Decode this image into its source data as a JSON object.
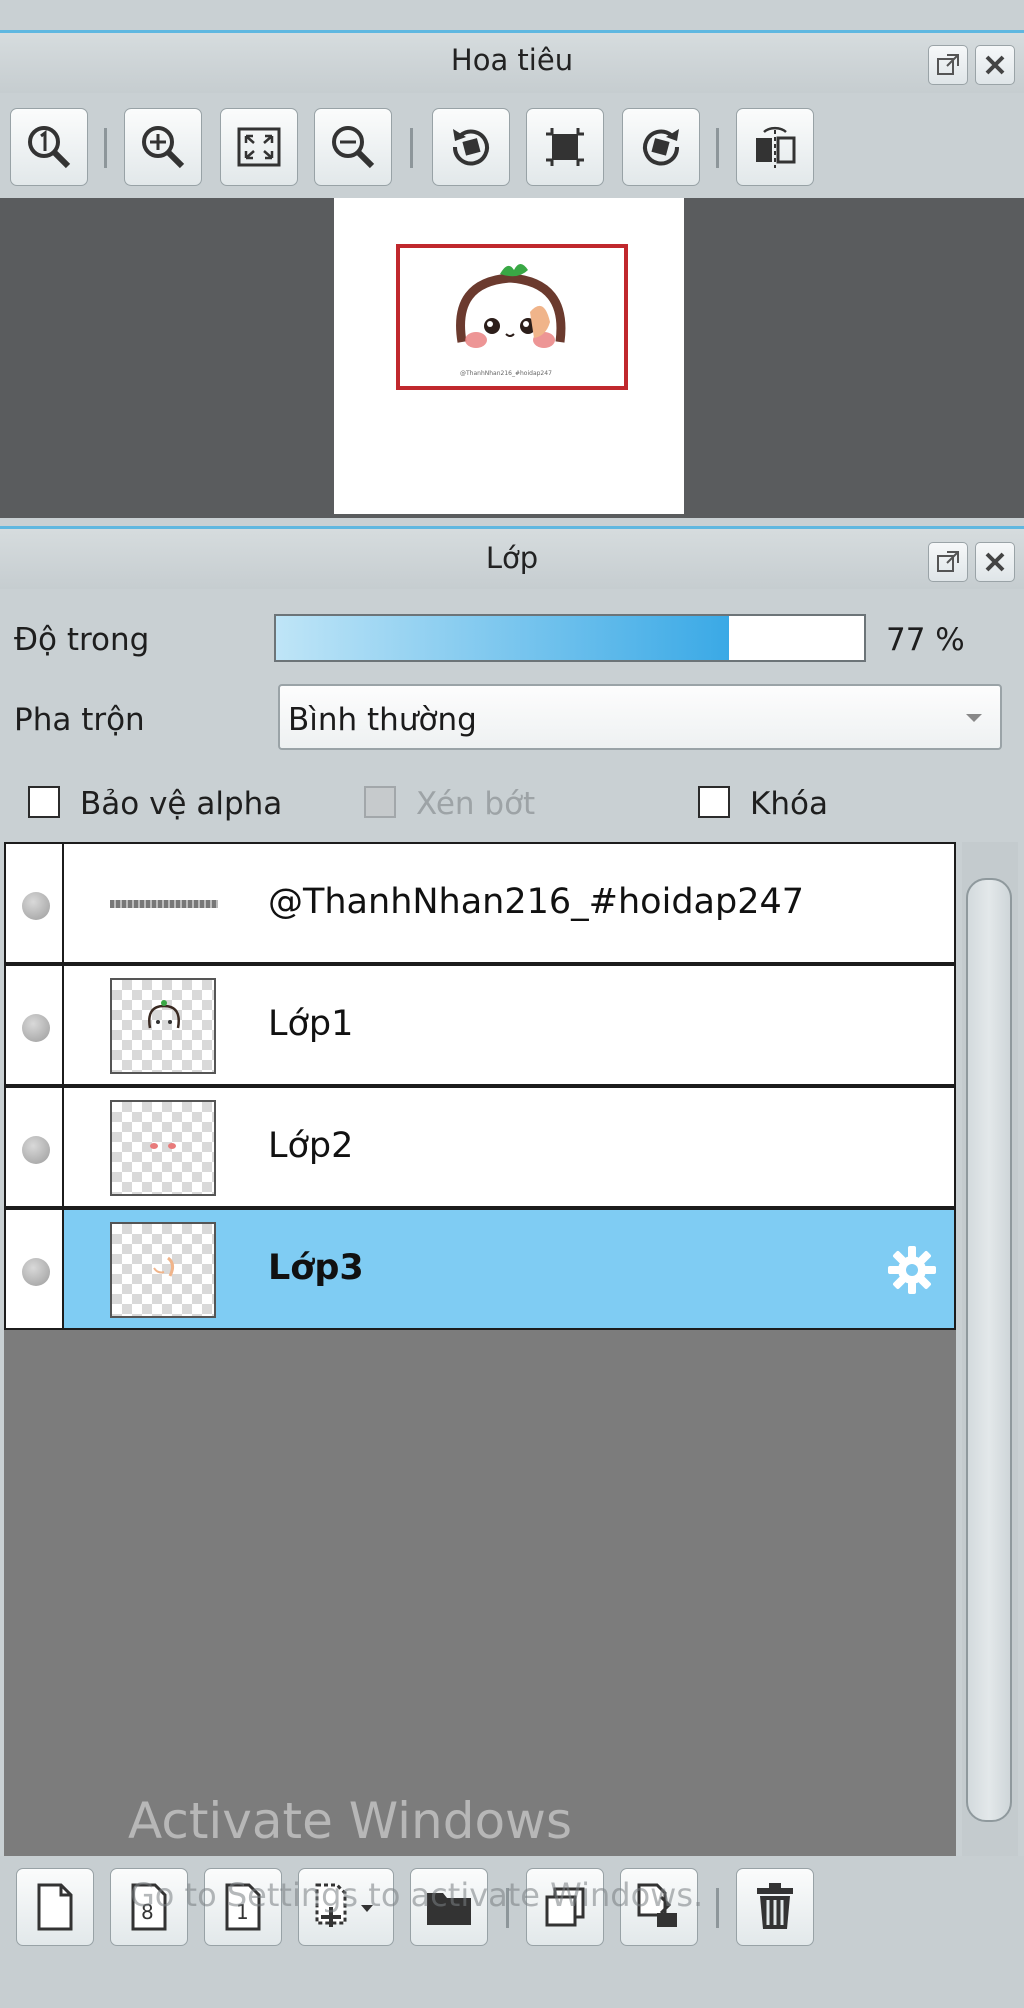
{
  "navigator": {
    "title": "Hoa tiêu",
    "toolbar_icons": [
      "zoom-100-icon",
      "zoom-in-icon",
      "fit-screen-icon",
      "zoom-out-icon",
      "rotate-left-icon",
      "crop-fit-icon",
      "rotate-right-icon",
      "flip-icon"
    ],
    "preview_caption": "@ThanhNhan216_#hoidap247"
  },
  "layers_panel": {
    "title": "Lớp",
    "opacity_label": "Độ trong",
    "opacity_value": "77 %",
    "opacity_fraction": 0.77,
    "blend_label": "Pha trộn",
    "blend_value": "Bình thường",
    "checkbox_alpha": "Bảo vệ alpha",
    "checkbox_clip": "Xén bớt",
    "checkbox_lock": "Khóa",
    "layers": [
      {
        "name": "@ThanhNhan216_#hoidap247",
        "selected": false
      },
      {
        "name": "Lớp1",
        "selected": false
      },
      {
        "name": "Lớp2",
        "selected": false
      },
      {
        "name": "Lớp3",
        "selected": true
      }
    ]
  },
  "watermark": {
    "line1": "Activate Windows",
    "line2": "Go to Settings to activate Windows."
  },
  "colors": {
    "accent": "#5fb7e0",
    "selected_row": "#7fccf3",
    "nav_bg": "#5a5c5e",
    "frame_red": "#c0282d"
  }
}
